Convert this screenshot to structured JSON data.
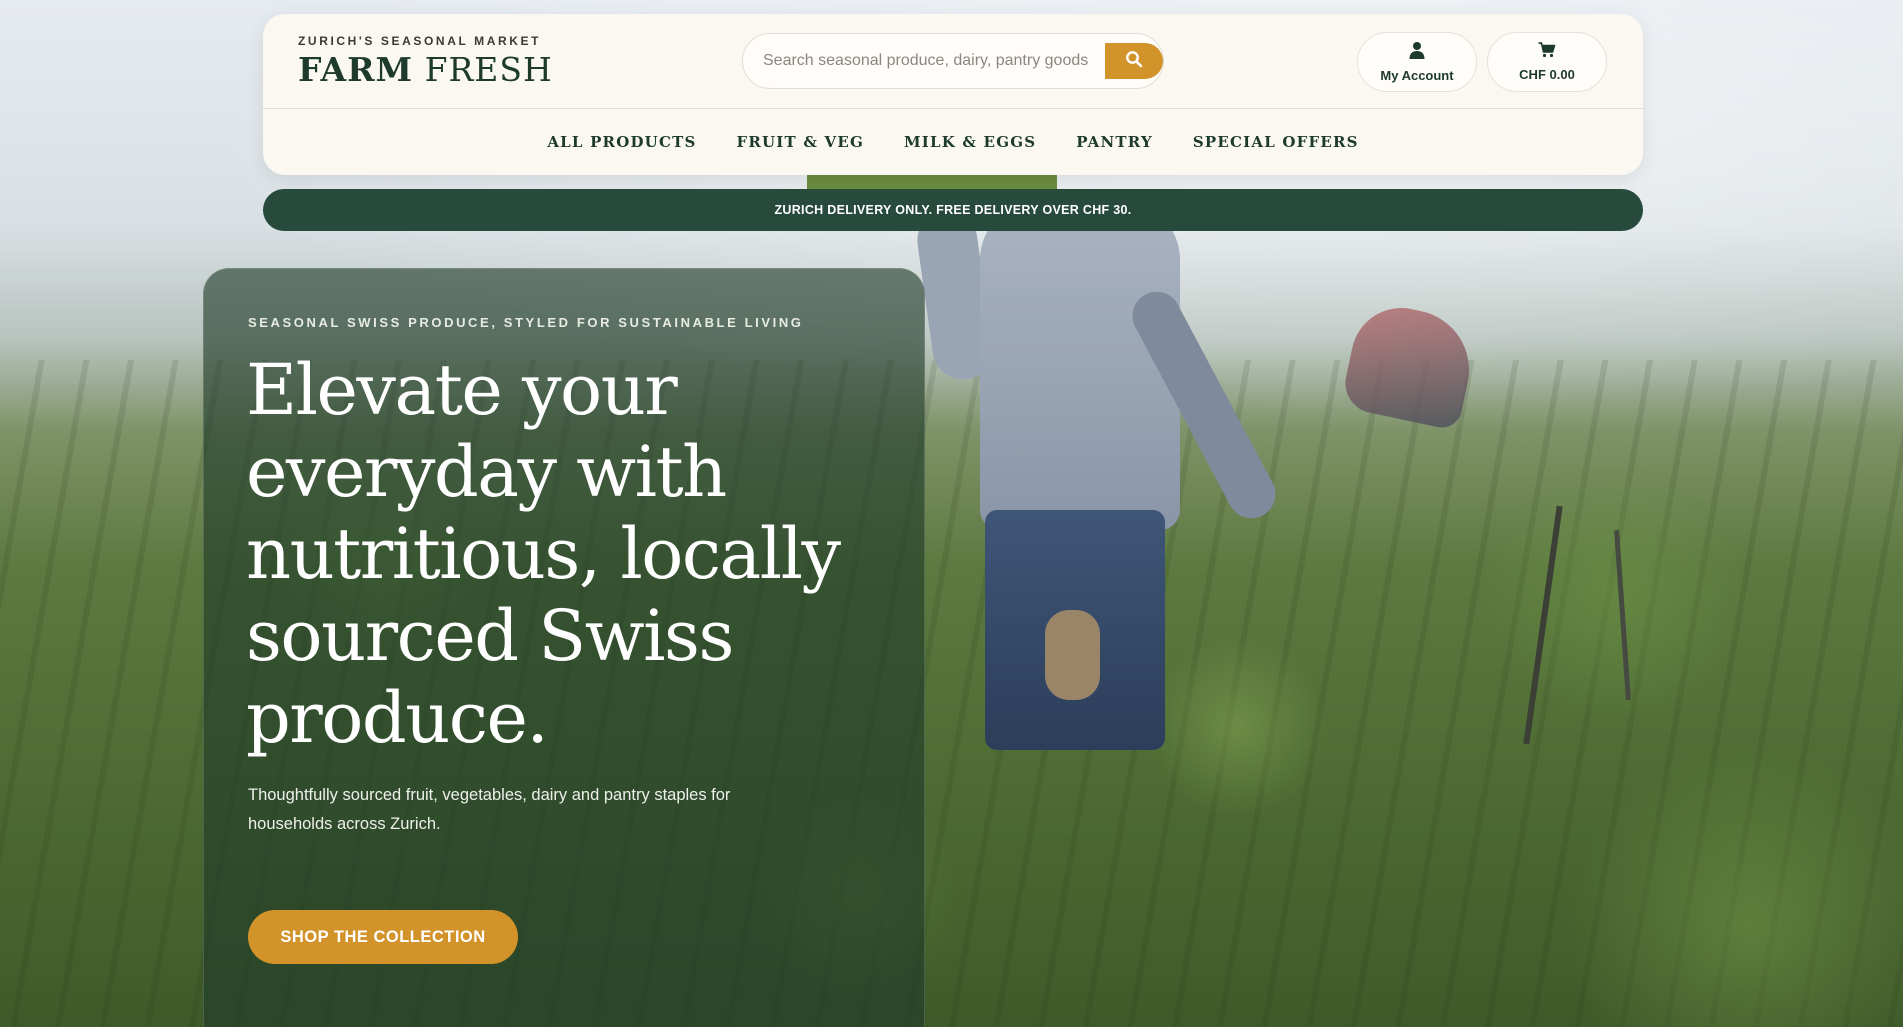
{
  "brand": {
    "eyebrow": "ZURICH'S SEASONAL MARKET",
    "title_bold": "FARM",
    "title_light": "FRESH"
  },
  "search": {
    "placeholder": "Search seasonal produce, dairy, pantry goods",
    "button_icon": "search-icon"
  },
  "account": {
    "label": "My Account",
    "icon": "user-icon"
  },
  "cart": {
    "label": "CHF 0.00",
    "icon": "cart-icon"
  },
  "nav": {
    "items": [
      {
        "label": "ALL PRODUCTS"
      },
      {
        "label": "FRUIT & VEG"
      },
      {
        "label": "MILK & EGGS"
      },
      {
        "label": "PANTRY"
      },
      {
        "label": "SPECIAL OFFERS"
      }
    ]
  },
  "delivery_banner": "ZURICH DELIVERY ONLY. FREE DELIVERY OVER CHF 30.",
  "hero": {
    "eyebrow": "SEASONAL SWISS PRODUCE, STYLED FOR SUSTAINABLE LIVING",
    "title": "Elevate your everyday with nutritious, locally sourced Swiss produce.",
    "description": "Thoughtfully sourced fruit, vegetables, dairy and pantry staples for households across Zurich.",
    "cta": "SHOP THE COLLECTION"
  },
  "colors": {
    "accent": "#d3932b",
    "brand_green": "#1d3a2c",
    "banner_green": "#274a3d",
    "header_bg": "#fbf8f2"
  }
}
